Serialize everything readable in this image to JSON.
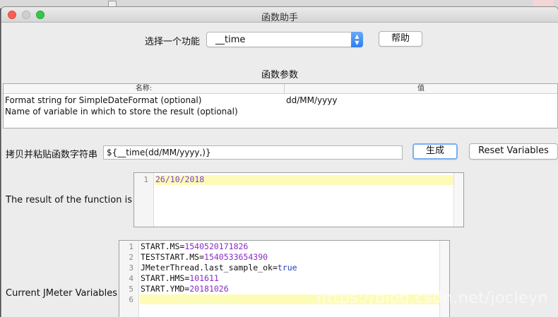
{
  "window": {
    "title": "函数助手"
  },
  "function_select": {
    "label": "选择一个功能",
    "selected": "__time"
  },
  "help_button": {
    "label": "帮助"
  },
  "params": {
    "section_title": "函数参数",
    "columns": [
      "名称:",
      "值"
    ],
    "rows": [
      {
        "name": "Format string for SimpleDateFormat (optional)",
        "value": "dd/MM/yyyy"
      },
      {
        "name": "Name of variable in which to store the result (optional)",
        "value": ""
      }
    ]
  },
  "copy_paste": {
    "label": "拷贝并粘贴函数字符串",
    "value": "${__time(dd/MM/yyyy,)}"
  },
  "generate_button": {
    "label": "生成"
  },
  "reset_button": {
    "label": "Reset Variables"
  },
  "result": {
    "label": "The result of the function is",
    "lines": [
      {
        "num": "1",
        "text": "26/10/2018"
      }
    ]
  },
  "variables": {
    "label": "Current JMeter Variables",
    "lines": [
      {
        "num": "1",
        "key": "START.MS",
        "eq": "=",
        "value": "1540520171826"
      },
      {
        "num": "2",
        "key": "TESTSTART.MS",
        "eq": "=",
        "value": "1540533654390"
      },
      {
        "num": "3",
        "key": "JMeterThread.last_sample_ok",
        "eq": "=",
        "value": "true"
      },
      {
        "num": "4",
        "key": "START.HMS",
        "eq": "=",
        "value": "101611"
      },
      {
        "num": "5",
        "key": "START.YMD",
        "eq": "=",
        "value": "20181026"
      },
      {
        "num": "6",
        "key": "",
        "eq": "",
        "value": ""
      }
    ]
  },
  "watermark": "https://blog.csdn.net/jocleyn",
  "colors": {
    "highlight": "#fdfbb8",
    "number": "#8b2ac9",
    "keyword": "#1f3fc4",
    "accent": "#2e7ef0"
  }
}
